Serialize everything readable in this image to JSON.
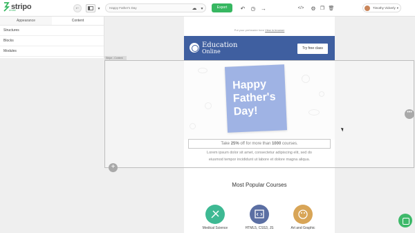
{
  "app": {
    "logo_text": "stripo",
    "logo_sub": "email"
  },
  "toolbar": {
    "subject_value": "Happy Father's Day",
    "export_label": "Export",
    "user_name": "Timothy Vickerly"
  },
  "sidebar": {
    "tabs": [
      {
        "label": "Appearance",
        "active": false
      },
      {
        "label": "Content",
        "active": true
      }
    ],
    "items": [
      {
        "label": "Structures"
      },
      {
        "label": "Blocks"
      },
      {
        "label": "Modules"
      }
    ]
  },
  "email": {
    "preheader_text": "Put your preheader here",
    "preheader_link": "View in browser",
    "brand_line1": "Education",
    "brand_line2": "Online",
    "try_button": "Try free class",
    "block_tag": "Stripe - Content",
    "hero_line1": "Happy",
    "hero_line2": "Father's",
    "hero_line3": "Day!",
    "promo_pre": "Take ",
    "promo_pct": "25%",
    "promo_mid": " off for more than ",
    "promo_num": "1000",
    "promo_post": " courses.",
    "lorem_line1": "Lorem ipsum dolor sit amet, consectetur adipiscing elit, sed do",
    "lorem_line2": "eiusmod tempor incididunt ut labore et dolore magna aliqua.",
    "courses_title": "Most Popular Courses",
    "courses": [
      {
        "label": "Medical Science",
        "color": "#3eb993"
      },
      {
        "label": "HTML5, CSS3, JS",
        "color": "#5b6fa3"
      },
      {
        "label": "Art and Graphic",
        "color": "#d8a557"
      }
    ]
  },
  "colors": {
    "accent_green": "#37b761",
    "header_blue": "#3f5fa0",
    "card_blue": "#6c8bd6"
  }
}
